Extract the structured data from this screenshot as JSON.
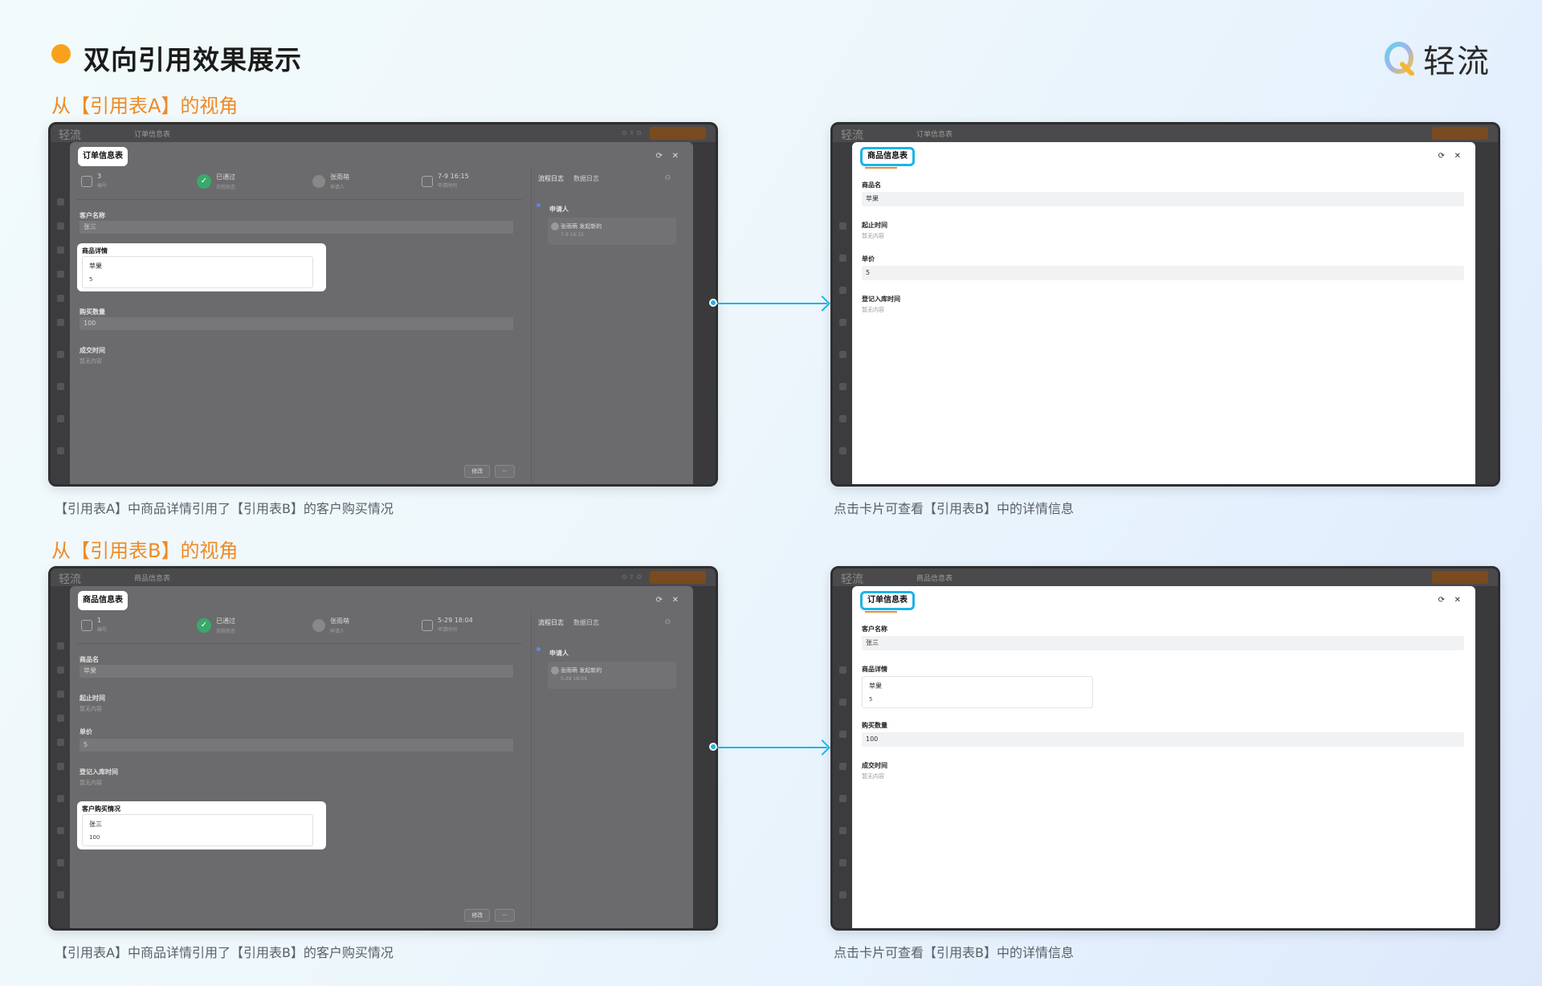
{
  "header": {
    "title": "双向引用效果展示",
    "brand": "轻流"
  },
  "colors": {
    "accent_orange": "#f08a26",
    "dot_orange": "#f9a11b",
    "highlight_blue": "#1db3e8"
  },
  "sections": [
    {
      "title": "从【引用表A】的视角",
      "left": {
        "app_logo": "轻流",
        "app_tab": "订单信息表",
        "modal_tab": "订单信息表",
        "strip": {
          "number": "3",
          "number_sub": "编号",
          "status": "已通过",
          "status_sub": "流程状态",
          "person": "张雨萌",
          "person_sub": "申请人",
          "time": "7-9 16:15",
          "time_sub": "申请时间"
        },
        "fields": [
          {
            "label": "客户名称",
            "value": "张三"
          }
        ],
        "highlight": {
          "title": "商品详情",
          "line1": "苹果",
          "line2": "5"
        },
        "fields_after": [
          {
            "label": "购买数量",
            "value": "100"
          },
          {
            "label": "成交时间",
            "empty": "暂无内容"
          }
        ],
        "right_tabs": [
          "流程日志",
          "数据日志"
        ],
        "log": {
          "label": "申请人",
          "name": "张雨萌",
          "action": "发起新的",
          "time": "7-9 16:15"
        },
        "buttons": [
          "修改",
          "···"
        ]
      },
      "right": {
        "app_logo": "轻流",
        "app_tab": "订单信息表",
        "modal_tab": "商品信息表",
        "fields": [
          {
            "label": "商品名",
            "value": "苹果"
          },
          {
            "label": "起止时间",
            "empty": "暂无内容"
          },
          {
            "label": "单价",
            "value": "5"
          },
          {
            "label": "登记入库时间",
            "empty": "暂无内容"
          }
        ]
      },
      "caption_left": "【引用表A】中商品详情引用了【引用表B】的客户购买情况",
      "caption_right": "点击卡片可查看【引用表B】中的详情信息"
    },
    {
      "title": "从【引用表B】的视角",
      "left": {
        "app_logo": "轻流",
        "app_tab": "商品信息表",
        "modal_tab": "商品信息表",
        "strip": {
          "number": "1",
          "number_sub": "编号",
          "status": "已通过",
          "status_sub": "流程状态",
          "person": "张雨萌",
          "person_sub": "申请人",
          "time": "5-29 18:04",
          "time_sub": "申请时间"
        },
        "fields": [
          {
            "label": "商品名",
            "value": "苹果"
          },
          {
            "label": "起止时间",
            "empty": "暂无内容"
          },
          {
            "label": "单价",
            "value": "5"
          },
          {
            "label": "登记入库时间",
            "empty": "暂无内容"
          }
        ],
        "highlight": {
          "title": "客户购买情况",
          "line1": "张三",
          "line2": "100"
        },
        "right_tabs": [
          "流程日志",
          "数据日志"
        ],
        "log": {
          "label": "申请人",
          "name": "张雨萌",
          "action": "发起新的",
          "time": "5-29 18:04"
        },
        "buttons": [
          "修改",
          "···"
        ]
      },
      "right": {
        "app_logo": "轻流",
        "app_tab": "商品信息表",
        "modal_tab": "订单信息表",
        "fields": [
          {
            "label": "客户名称",
            "value": "张三"
          },
          {
            "label": "商品详情",
            "card_line1": "苹果",
            "card_line2": "5"
          },
          {
            "label": "购买数量",
            "value": "100"
          },
          {
            "label": "成交时间",
            "empty": "暂无内容"
          }
        ]
      },
      "caption_left": "【引用表A】中商品详情引用了【引用表B】的客户购买情况",
      "caption_right": "点击卡片可查看【引用表B】中的详情信息"
    }
  ]
}
